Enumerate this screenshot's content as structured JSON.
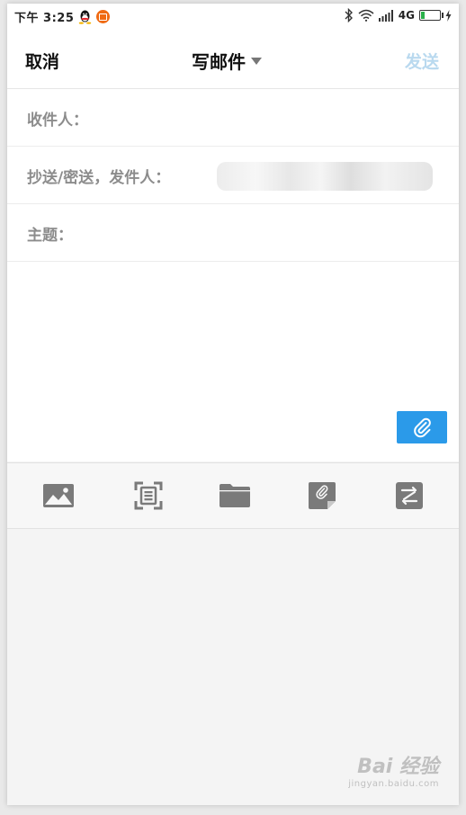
{
  "status_bar": {
    "time": "下午 3:25",
    "network": "4G",
    "battery_level": 0.2,
    "icons": [
      "qq-icon",
      "app-badge-icon",
      "bluetooth-icon",
      "wifi-icon",
      "signal-icon",
      "battery-icon",
      "charging-icon"
    ]
  },
  "header": {
    "cancel_label": "取消",
    "title": "写邮件",
    "send_label": "发送",
    "send_color": "#b9d9ef"
  },
  "fields": {
    "to_label": "收件人：",
    "cc_label": "抄送/密送，发件人：",
    "subject_label": "主题："
  },
  "body": {
    "attach_color": "#2b9ae9"
  },
  "toolbar": {
    "items": [
      "image-icon",
      "scan-icon",
      "folder-icon",
      "note-icon",
      "convert-icon"
    ]
  },
  "watermark": {
    "text": "Bai 经验",
    "url": "jingyan.baidu.com"
  }
}
